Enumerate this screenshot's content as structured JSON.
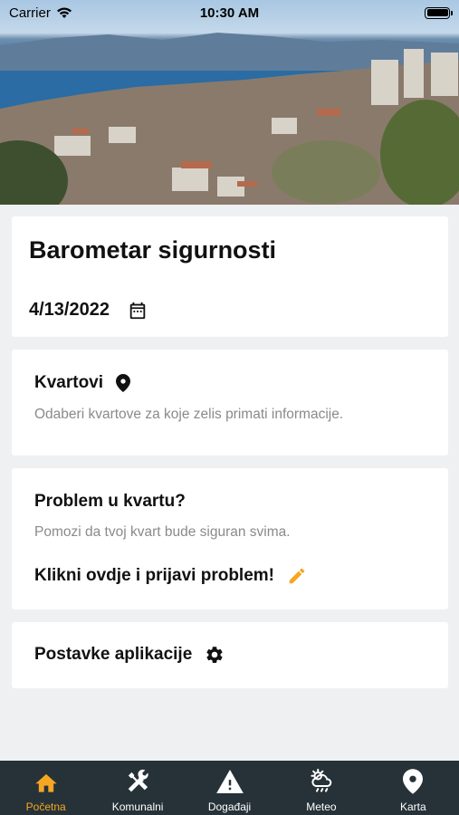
{
  "status_bar": {
    "carrier": "Carrier",
    "time": "10:30 AM"
  },
  "hero": {
    "icon": "city-harbor-photo"
  },
  "header_card": {
    "title": "Barometar sigurnosti",
    "date": "4/13/2022"
  },
  "neighborhoods": {
    "title": "Kvartovi",
    "description": "Odaberi kvartove za koje zelis primati informacije."
  },
  "problem": {
    "title": "Problem u kvartu?",
    "description": "Pomozi da tvoj kvart bude siguran svima.",
    "cta": "Klikni ovdje i prijavi problem!"
  },
  "settings": {
    "title": "Postavke aplikacije"
  },
  "tabs": [
    {
      "label": "Početna",
      "icon": "home-icon",
      "active": true
    },
    {
      "label": "Komunalni",
      "icon": "tools-icon",
      "active": false
    },
    {
      "label": "Događaji",
      "icon": "warning-icon",
      "active": false
    },
    {
      "label": "Meteo",
      "icon": "weather-icon",
      "active": false
    },
    {
      "label": "Karta",
      "icon": "map-pin-icon",
      "active": false
    }
  ],
  "colors": {
    "accent": "#f5a623",
    "tabbar": "#263238",
    "background": "#eef0f2"
  }
}
